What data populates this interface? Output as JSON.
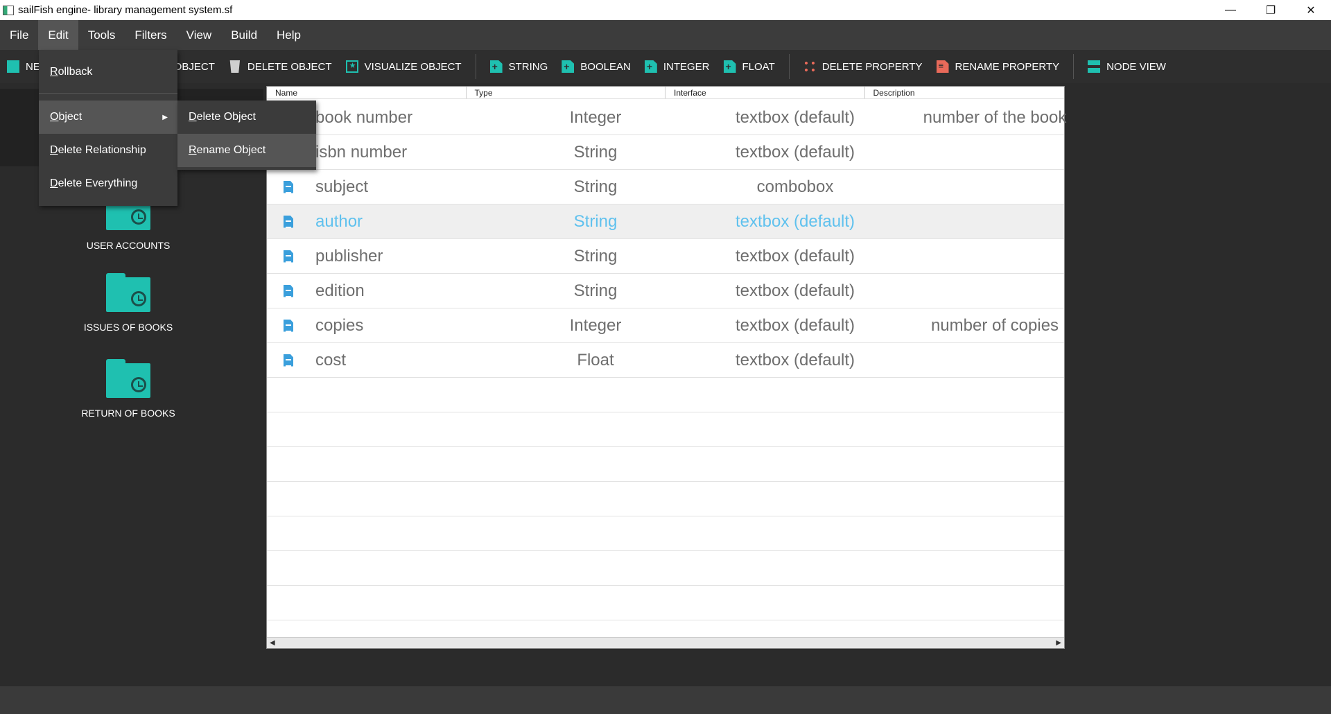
{
  "window": {
    "title": "sailFish engine- library management system.sf",
    "minimize": "—",
    "restore": "❐",
    "close": "✕"
  },
  "menubar": {
    "items": [
      {
        "label": "File"
      },
      {
        "label": "Edit"
      },
      {
        "label": "Tools"
      },
      {
        "label": "Filters"
      },
      {
        "label": "View"
      },
      {
        "label": "Build"
      },
      {
        "label": "Help"
      }
    ]
  },
  "toolbar": {
    "new_object": "NEW OBJECT",
    "rename_object": "RENAME OBJECT",
    "delete_object": "DELETE OBJECT",
    "visualize_object": "VISUALIZE OBJECT",
    "string": "STRING",
    "boolean": "BOOLEAN",
    "integer": "INTEGER",
    "float": "FLOAT",
    "delete_property": "DELETE PROPERTY",
    "rename_property": "RENAME PROPERTY",
    "node_view": "NODE VIEW"
  },
  "edit_menu": {
    "items": [
      {
        "label": "Rollback"
      },
      {
        "label": "Object"
      },
      {
        "label": "Delete Relationship"
      },
      {
        "label": "Delete Everything"
      }
    ]
  },
  "object_submenu": {
    "items": [
      {
        "label": "Delete Object"
      },
      {
        "label": "Rename Object"
      }
    ]
  },
  "folders": [
    {
      "label": "USER ACCOUNTS"
    },
    {
      "label": "ISSUES OF BOOKS"
    },
    {
      "label": "RETURN OF BOOKS"
    }
  ],
  "table": {
    "columns": [
      "Name",
      "Type",
      "Interface",
      "Description"
    ],
    "rows": [
      {
        "name": "book number",
        "type": "Integer",
        "interface": "textbox (default)",
        "description": "number of the book"
      },
      {
        "name": "isbn number",
        "type": "String",
        "interface": "textbox (default)",
        "description": ""
      },
      {
        "name": "subject",
        "type": "String",
        "interface": "combobox",
        "description": ""
      },
      {
        "name": "author",
        "type": "String",
        "interface": "textbox (default)",
        "description": "",
        "selected": true
      },
      {
        "name": "publisher",
        "type": "String",
        "interface": "textbox (default)",
        "description": ""
      },
      {
        "name": "edition",
        "type": "String",
        "interface": "textbox (default)",
        "description": ""
      },
      {
        "name": "copies",
        "type": "Integer",
        "interface": "textbox (default)",
        "description": "number of copies"
      },
      {
        "name": "cost",
        "type": "Float",
        "interface": "textbox (default)",
        "description": ""
      }
    ]
  },
  "colors": {
    "accent": "#1fc0b0",
    "selected_text": "#5fc1ee"
  }
}
